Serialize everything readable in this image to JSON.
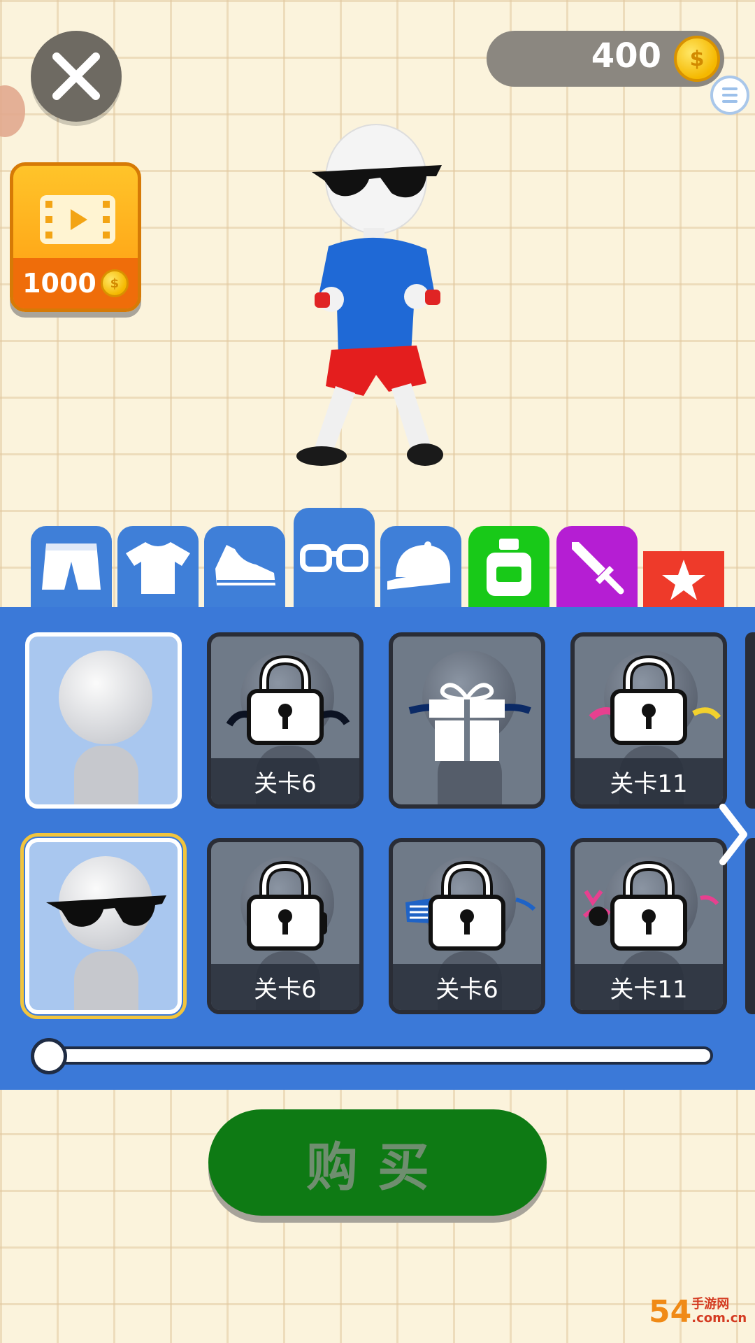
{
  "header": {
    "coin_balance": "400",
    "coin_symbol": "$"
  },
  "video_reward": {
    "price": "1000",
    "coin_symbol": "$"
  },
  "tabs": [
    {
      "name": "pants",
      "icon": "shorts-icon",
      "active": false
    },
    {
      "name": "shirt",
      "icon": "tshirt-icon",
      "active": false
    },
    {
      "name": "shoes",
      "icon": "sneaker-icon",
      "active": false
    },
    {
      "name": "glasses",
      "icon": "glasses-icon",
      "active": true
    },
    {
      "name": "hat",
      "icon": "cap-icon",
      "active": false
    },
    {
      "name": "potion",
      "icon": "bottle-icon",
      "active": false
    },
    {
      "name": "weapon",
      "icon": "sword-icon",
      "active": false
    },
    {
      "name": "favorites",
      "icon": "star-icon",
      "active": false
    }
  ],
  "items": [
    {
      "state": "owned",
      "label": ""
    },
    {
      "state": "locked",
      "label": "关卡6"
    },
    {
      "state": "gift",
      "label": ""
    },
    {
      "state": "locked",
      "label": "关卡11"
    },
    {
      "state": "owned-selected",
      "label": ""
    },
    {
      "state": "locked",
      "label": "关卡6"
    },
    {
      "state": "locked",
      "label": "关卡6"
    },
    {
      "state": "locked",
      "label": "关卡11"
    }
  ],
  "scroll_progress": 0,
  "buy_button": {
    "label": "购买"
  },
  "watermark": {
    "number": "54",
    "text_line1": "手游网",
    "text_line2": ".com.cn"
  },
  "colors": {
    "panel": "#3b79d8",
    "buy": "#0e7a14",
    "coin": "#f5b800"
  }
}
